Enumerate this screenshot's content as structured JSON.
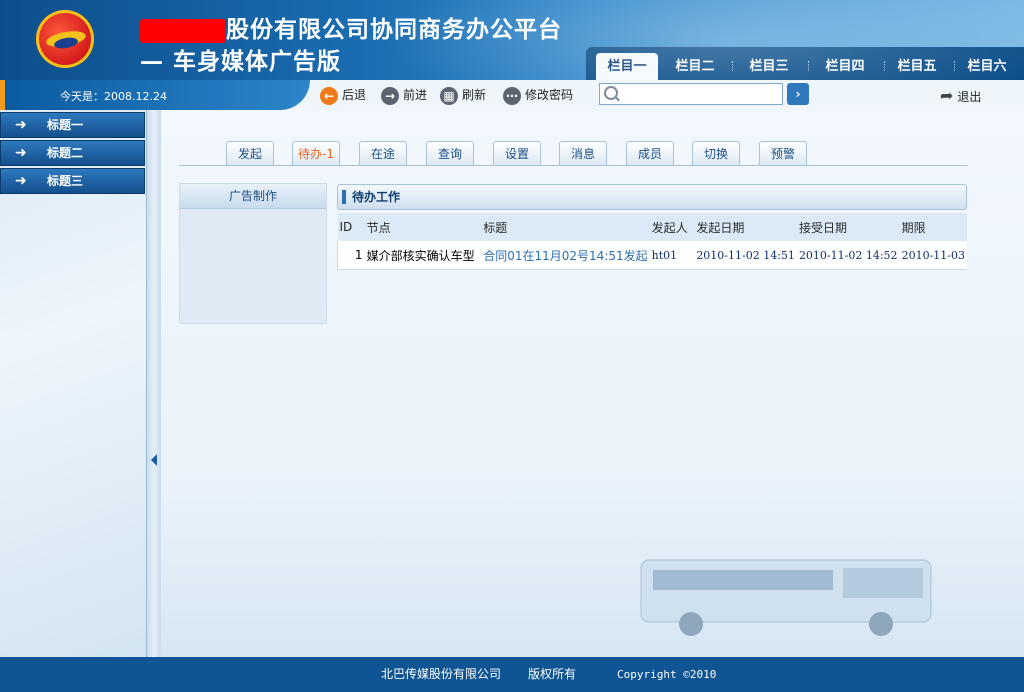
{
  "header": {
    "title_suffix": "股份有限公司协同商务办公平台",
    "subtitle": "— 车身媒体广告版"
  },
  "top_tabs": [
    "栏目一",
    "栏目二",
    "栏目三",
    "栏目四",
    "栏目五",
    "栏目六"
  ],
  "toolbar": {
    "date_text": "今天是：2008.12.24",
    "back": "后退",
    "forward": "前进",
    "refresh": "刷新",
    "change_password": "修改密码",
    "search_value": "",
    "logout": "退出"
  },
  "sidebar": {
    "items": [
      {
        "label": "标题一"
      },
      {
        "label": "标题二"
      },
      {
        "label": "标题三"
      }
    ]
  },
  "content_tabs": [
    "发起",
    "待办-1",
    "在途",
    "查询",
    "设置",
    "消息",
    "成员",
    "切换",
    "预警"
  ],
  "left_panel": {
    "header": "广告制作"
  },
  "panel_title": "待办工作",
  "table": {
    "headers": [
      "ID",
      "节点",
      "标题",
      "发起人",
      "发起日期",
      "接受日期",
      "期限"
    ],
    "rows": [
      [
        "1",
        "媒介部核实确认车型",
        "合同01在11月02号14:51发起",
        "ht01",
        "2010-11-02 14:51",
        "2010-11-02 14:52",
        "2010-11-03"
      ]
    ]
  },
  "footer": {
    "company": "北巴传媒股份有限公司",
    "rights": "版权所有",
    "copyright": "Copyright ©2010"
  },
  "colors": {
    "brand_blue": "#0f5493",
    "active_tab": "#e8641e",
    "link": "#2a6fb0"
  }
}
